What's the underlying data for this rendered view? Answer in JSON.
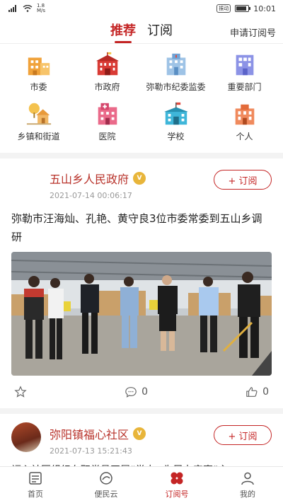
{
  "status_bar": {
    "net_speed_top": "1.8",
    "net_speed_bottom": "M/s",
    "vibrate": "振动",
    "time": "10:01"
  },
  "header": {
    "tabs": [
      {
        "label": "推荐",
        "active": true
      },
      {
        "label": "订阅",
        "active": false
      }
    ],
    "apply_label": "申请订阅号"
  },
  "categories": [
    {
      "label": "市委",
      "icon": "building-icon"
    },
    {
      "label": "市政府",
      "icon": "government-building-icon"
    },
    {
      "label": "弥勒市纪委监委",
      "icon": "office-building-icon"
    },
    {
      "label": "重要部门",
      "icon": "department-icon"
    },
    {
      "label": "乡镇和街道",
      "icon": "town-icon"
    },
    {
      "label": "医院",
      "icon": "hospital-icon"
    },
    {
      "label": "学校",
      "icon": "school-icon"
    },
    {
      "label": "个人",
      "icon": "person-icon"
    }
  ],
  "feed": [
    {
      "source": "五山乡人民政府",
      "badge": "V",
      "time": "2021-07-14 00:06:17",
      "subscribe_label": "+ 订阅",
      "title": "弥勒市汪海灿、孔艳、黄守良3位市委常委到五山乡调研",
      "comments": "0",
      "likes": "0"
    },
    {
      "source": "弥阳镇福心社区",
      "badge": "V",
      "time": "2021-07-13 15:21:43",
      "subscribe_label": "+ 订阅",
      "title": "福心社区组织在职党员开展“党史+为民办实事”主"
    }
  ],
  "tabbar": [
    {
      "label": "首页",
      "icon": "newspaper-icon",
      "active": false
    },
    {
      "label": "便民云",
      "icon": "cloud-icon",
      "active": false
    },
    {
      "label": "订阅号",
      "icon": "clover-icon",
      "active": true
    },
    {
      "label": "我的",
      "icon": "user-icon",
      "active": false
    }
  ],
  "colors": {
    "accent": "#c42525",
    "badge": "#e8b53a"
  }
}
